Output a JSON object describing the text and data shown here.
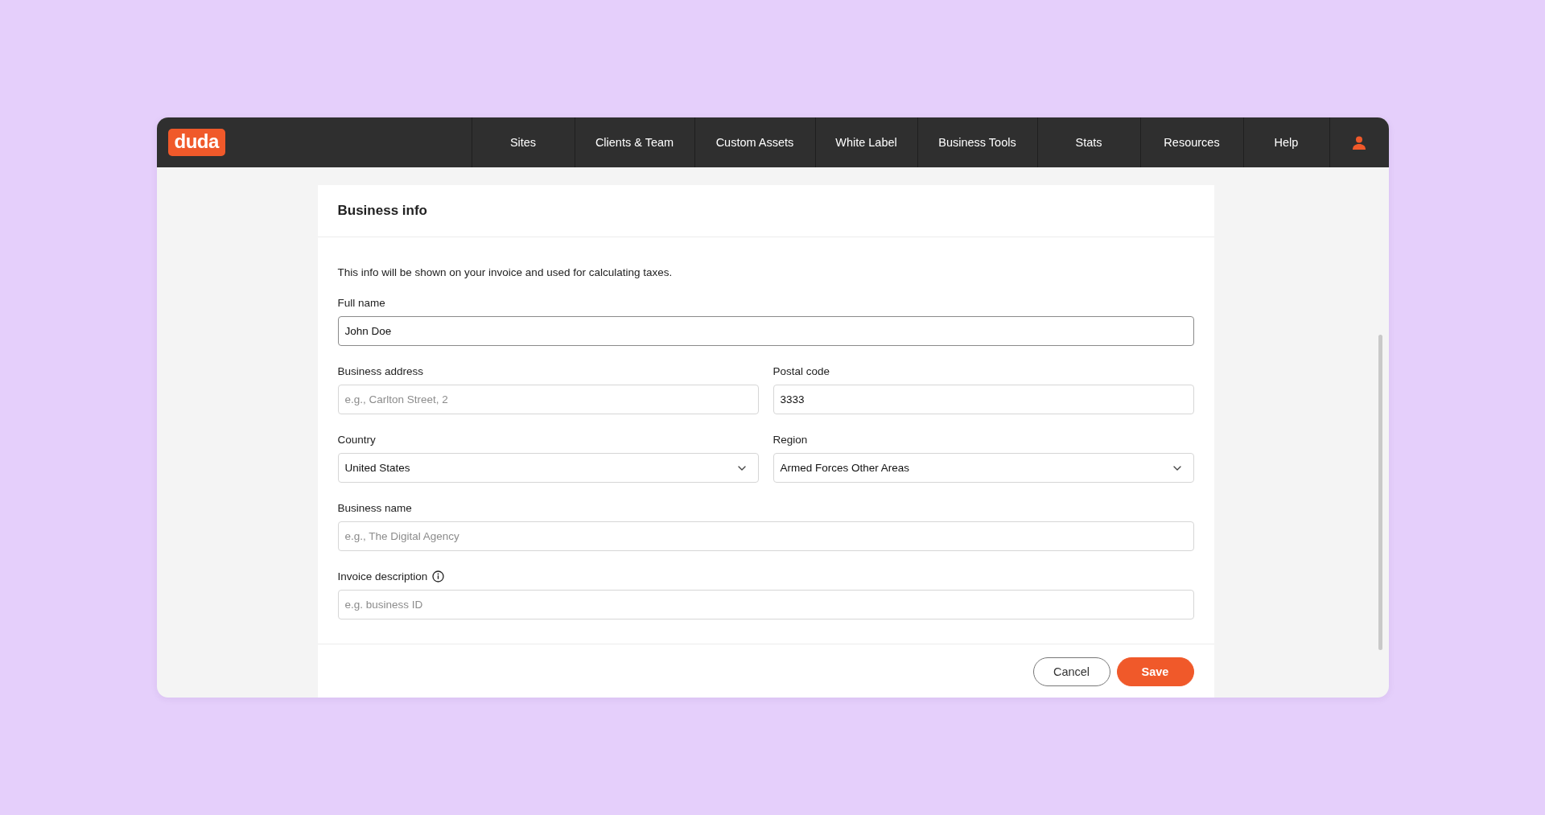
{
  "brand": {
    "logo": "duda"
  },
  "nav": [
    {
      "label": "Sites"
    },
    {
      "label": "Clients & Team"
    },
    {
      "label": "Custom Assets"
    },
    {
      "label": "White Label"
    },
    {
      "label": "Business Tools"
    },
    {
      "label": "Stats"
    },
    {
      "label": "Resources"
    },
    {
      "label": "Help"
    }
  ],
  "card": {
    "title": "Business info",
    "intro": "This info will be shown on your invoice and used for calculating taxes.",
    "rows": [
      [
        {
          "label": "Full name",
          "kind": "text",
          "value": "John Doe",
          "focused": true,
          "info_icon": false
        }
      ],
      [
        {
          "label": "Business address",
          "kind": "text",
          "placeholder": "e.g., Carlton Street, 2",
          "focused": false,
          "info_icon": false
        },
        {
          "label": "Postal code",
          "kind": "text",
          "value": "3333",
          "focused": false,
          "info_icon": false
        }
      ],
      [
        {
          "label": "Country",
          "kind": "select",
          "value": "United States",
          "focused": false,
          "info_icon": false
        },
        {
          "label": "Region",
          "kind": "select",
          "value": "Armed Forces Other Areas",
          "focused": false,
          "info_icon": false
        }
      ],
      [
        {
          "label": "Business name",
          "kind": "text",
          "placeholder": "e.g., The Digital Agency",
          "focused": false,
          "info_icon": false
        }
      ],
      [
        {
          "label": "Invoice description",
          "kind": "text",
          "placeholder": "e.g. business ID",
          "focused": false,
          "info_icon": true
        }
      ]
    ],
    "buttons": [
      {
        "label": "Cancel",
        "kind": "secondary"
      },
      {
        "label": "Save",
        "kind": "primary"
      }
    ]
  }
}
